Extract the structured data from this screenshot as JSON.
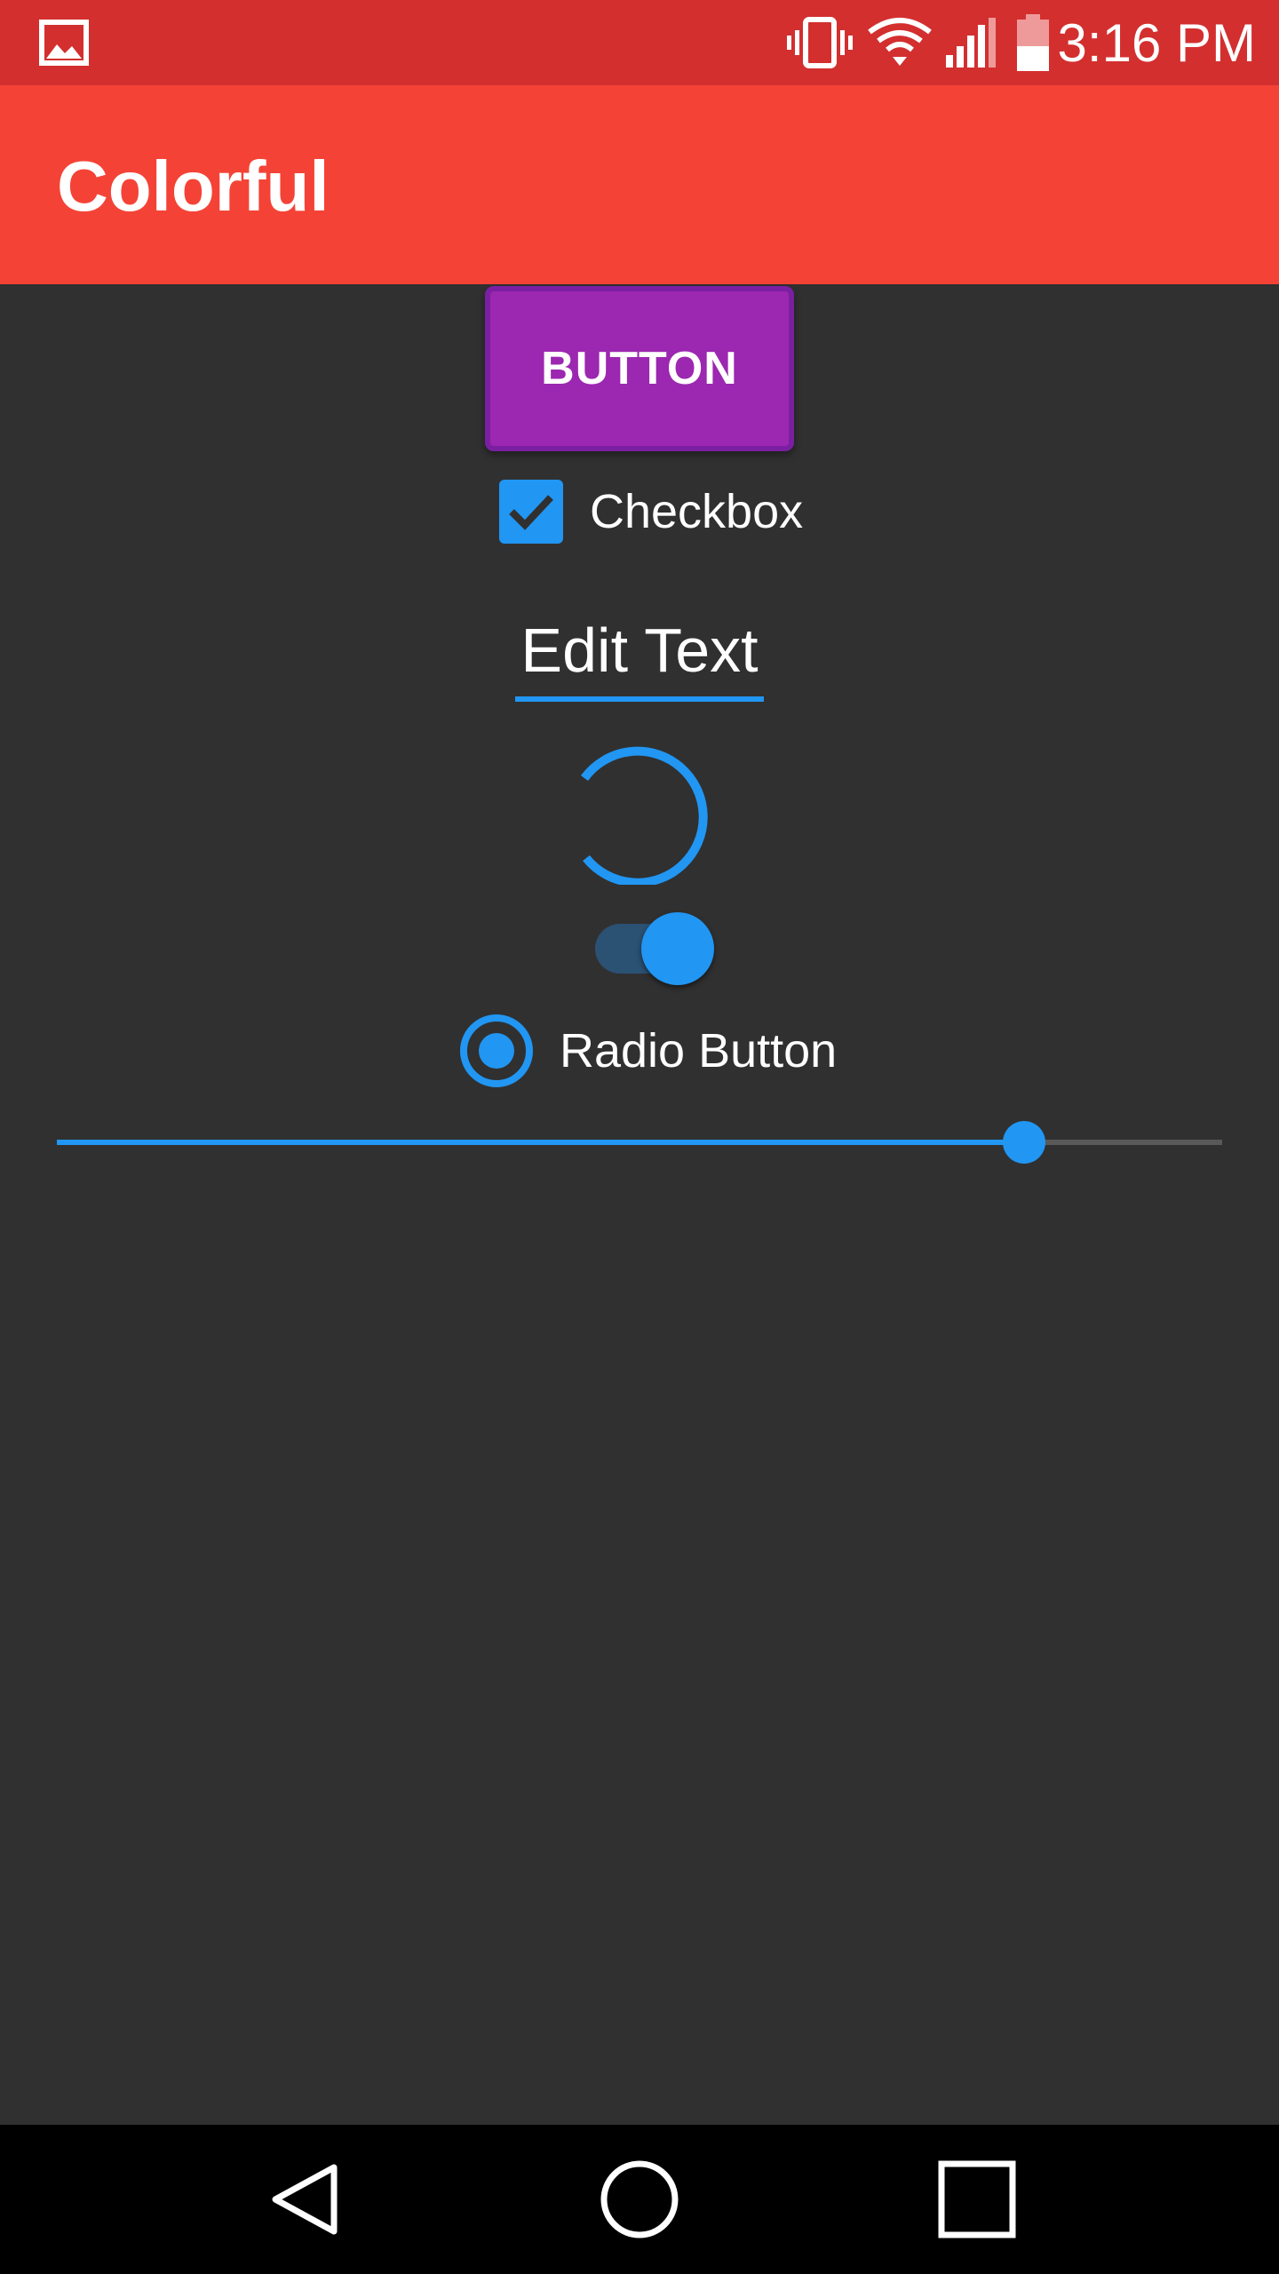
{
  "status_bar": {
    "time": "3:16 PM",
    "icons": [
      "gallery-icon",
      "vibrate-icon",
      "wifi-icon",
      "cell-signal-icon",
      "battery-icon"
    ]
  },
  "app_bar": {
    "title": "Colorful",
    "color": "#f44336"
  },
  "content": {
    "button_label": "BUTTON",
    "checkbox": {
      "label": "Checkbox",
      "checked": true
    },
    "edit_text": {
      "value": "Edit Text"
    },
    "switch": {
      "on": true
    },
    "radio": {
      "label": "Radio Button",
      "selected": true
    },
    "slider": {
      "value_fraction": 0.83
    }
  },
  "colors": {
    "accent": "#2196f3",
    "button": "#9c27b0",
    "status_bar": "#d32f2f",
    "background": "#303030"
  },
  "nav_bar": {
    "icons": [
      "back-icon",
      "home-icon",
      "recents-icon"
    ]
  }
}
